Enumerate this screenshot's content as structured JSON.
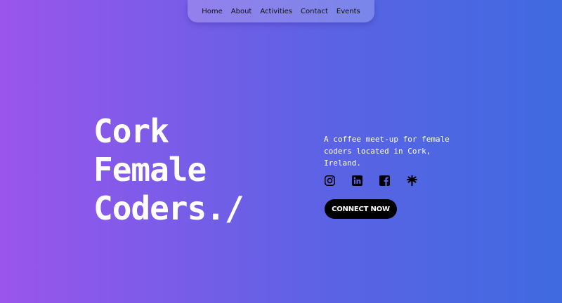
{
  "nav": {
    "items": [
      {
        "label": "Home"
      },
      {
        "label": "About"
      },
      {
        "label": "Activities"
      },
      {
        "label": "Contact"
      },
      {
        "label": "Events"
      }
    ]
  },
  "hero": {
    "title_lines": [
      "Cork",
      "Female",
      "Coders./"
    ],
    "tagline": "A coffee meet-up for female coders located in Cork, Ireland.",
    "cta_label": "CONNECT NOW"
  },
  "socials": [
    "instagram-icon",
    "linkedin-icon",
    "facebook-icon",
    "linktree-icon"
  ],
  "colors": {
    "gradient_start": "#9a55ec",
    "gradient_end": "#3f6ae0",
    "cta_bg": "#000000",
    "text": "#ffffff"
  }
}
